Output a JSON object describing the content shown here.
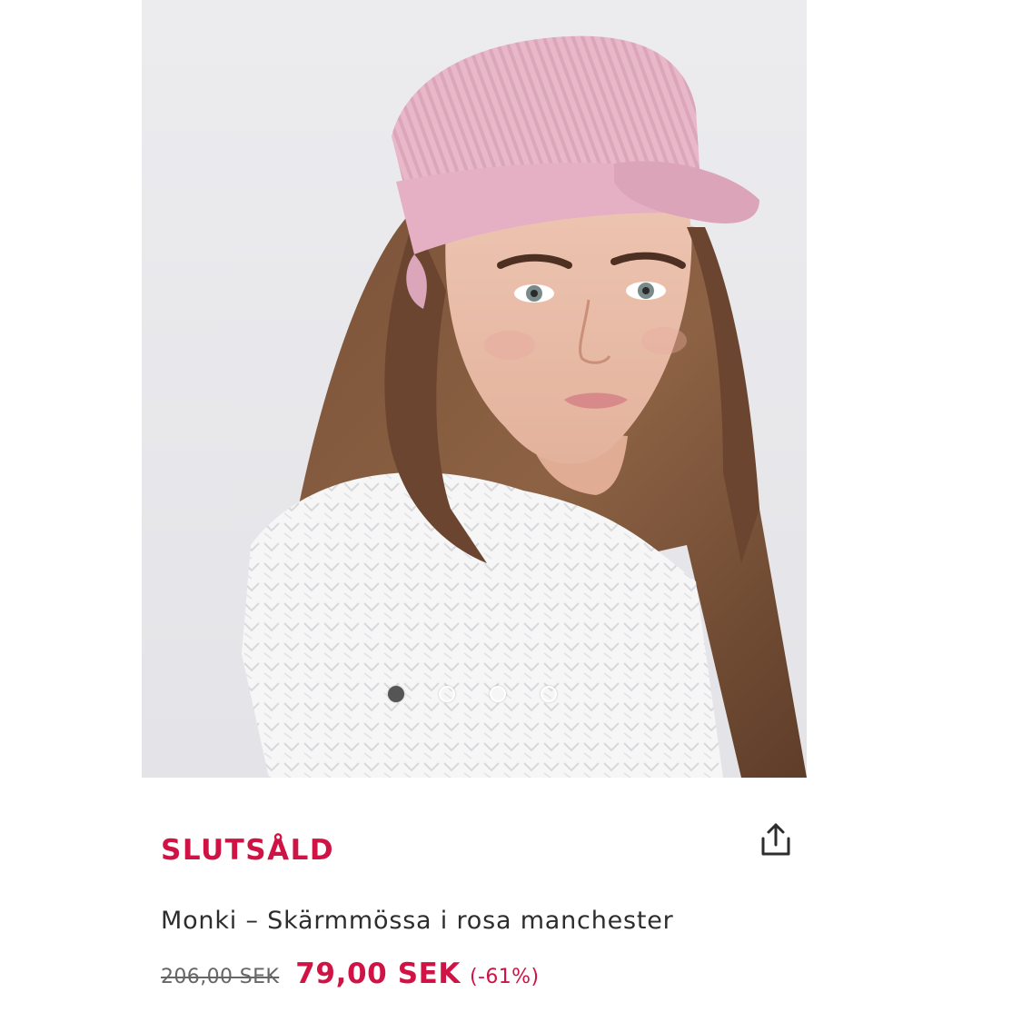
{
  "product": {
    "status": "SLUTSÅLD",
    "title": "Monki – Skärmmössa i rosa manchester",
    "old_price": "206,00 SEK",
    "new_price": "79,00 SEK",
    "discount": "(-61%)"
  },
  "gallery": {
    "total_images": 4,
    "active_index": 0
  },
  "icons": {
    "share": "share-icon"
  },
  "colors": {
    "accent": "#d01345",
    "text": "#2d2d2d",
    "muted": "#666666",
    "image_background": "#e9e9ec"
  }
}
